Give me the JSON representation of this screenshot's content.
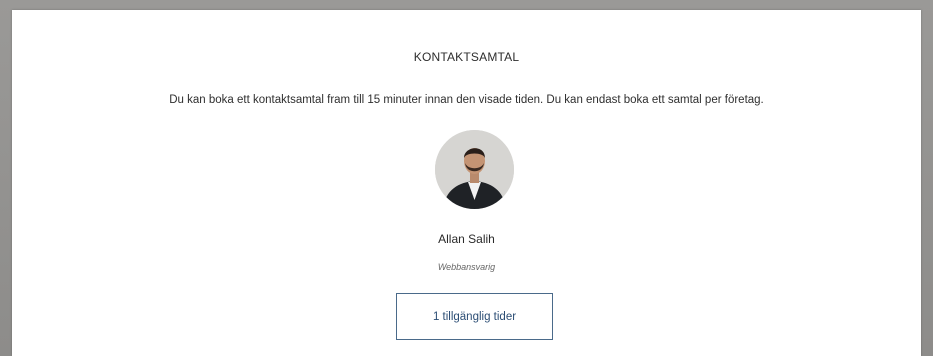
{
  "section": {
    "title": "KONTAKTSAMTAL",
    "description": "Du kan boka ett kontaktsamtal fram till 15 minuter innan den visade tiden. Du kan endast boka ett samtal per företag."
  },
  "contact": {
    "name": "Allan Salih",
    "role": "Webbansvarig"
  },
  "actions": {
    "available_times_label": "1 tillgänglig tider"
  },
  "colors": {
    "button_border": "#4a6a8a",
    "button_text": "#2b4d74",
    "outer_background": "#8f8e8c"
  }
}
